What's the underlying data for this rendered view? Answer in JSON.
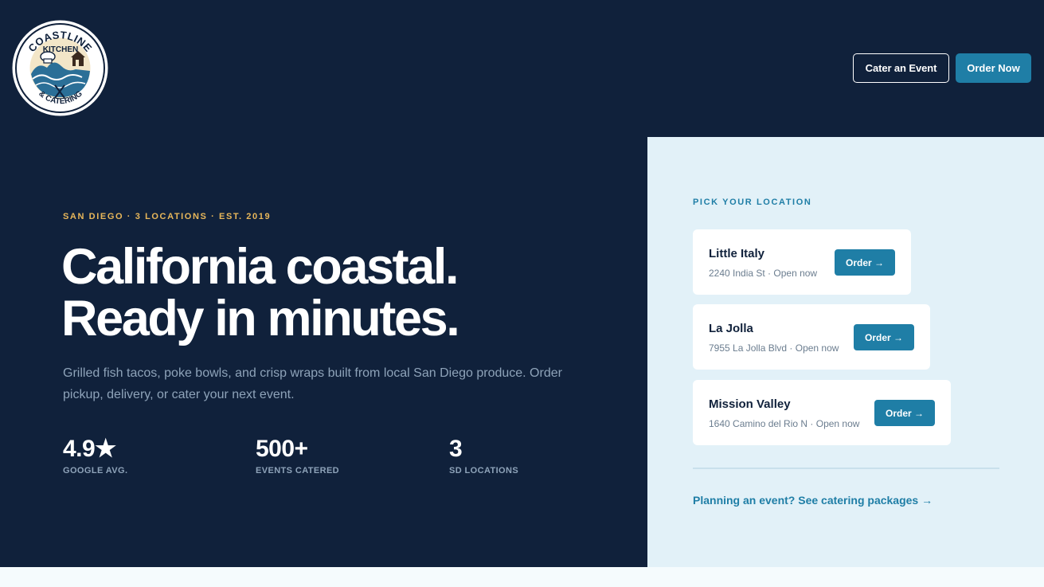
{
  "header": {
    "logo": {
      "name": "Coastline Kitchen & Catering logo",
      "line1": "COASTLINE",
      "line2": "KITCHEN",
      "line3": "& CATERING"
    },
    "cater_button": "Cater an Event",
    "order_button": "Order Now"
  },
  "hero": {
    "eyebrow": "SAN DIEGO · 3 LOCATIONS · EST. 2019",
    "headline_line1": "California coastal.",
    "headline_line2": "Ready in minutes.",
    "subtitle": "Grilled fish tacos, poke bowls, and crisp wraps built from local San Diego produce. Order pickup, delivery, or cater your next event.",
    "stats": [
      {
        "value": "4.9★",
        "label": "GOOGLE AVG."
      },
      {
        "value": "500+",
        "label": "EVENTS CATERED"
      },
      {
        "value": "3",
        "label": "SD LOCATIONS"
      }
    ]
  },
  "locations_panel": {
    "title": "PICK YOUR LOCATION",
    "locations": [
      {
        "name": "Little Italy",
        "meta": "2240 India St · Open now",
        "order_label": "Order →"
      },
      {
        "name": "La Jolla",
        "meta": "7955 La Jolla Blvd · Open now",
        "order_label": "Order →"
      },
      {
        "name": "Mission Valley",
        "meta": "1640 Camino del Rio N · Open now",
        "order_label": "Order →"
      }
    ],
    "catering_link": "Planning an event? See catering packages →"
  },
  "colors": {
    "navy": "#10213b",
    "accent_blue": "#1f7ea6",
    "gold": "#e8b75a",
    "panel_bg": "#e2f1f8",
    "muted_text": "#8ea3b9"
  }
}
